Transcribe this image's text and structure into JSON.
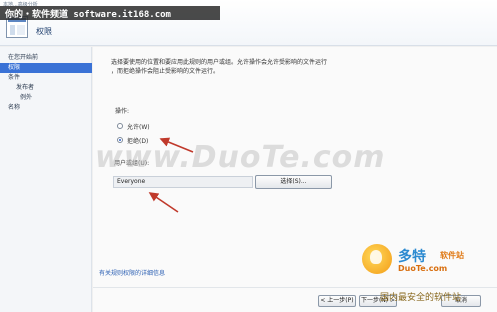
{
  "window": {
    "title": "本地...高级分析"
  },
  "header": {
    "title": "权限"
  },
  "watermark_top": "你的・软件频道 software.it168.com",
  "watermark_center": "www.DuoTe.com",
  "nav": {
    "items": [
      {
        "label": "在您开始前"
      },
      {
        "label": "权限"
      },
      {
        "label": "条件"
      },
      {
        "label": "发布者"
      },
      {
        "label": "例外"
      },
      {
        "label": "名称"
      }
    ]
  },
  "main": {
    "description_line1": "选择要使用的位置和要应用此规则的用户或组。允许操作会允许受影响的文件运行",
    "description_line2": "，而拒绝操作会阻止受影响的文件运行。",
    "operation_label": "操作:",
    "radio_allow": "允许(W)",
    "radio_deny": "拒绝(D)",
    "selected_operation": "拒绝(D)",
    "user_group_label": "用户或组(U):",
    "user_group_value": "Everyone",
    "select_button": "选择(S)...",
    "help_link": "有关规则权限的详细信息"
  },
  "footer": {
    "prev_button": "< 上一步(P)",
    "next_button": "下一步(N) >",
    "cancel_button": "取消"
  },
  "logo": {
    "cn": "多特",
    "cn2": "软件站",
    "en": "DuoTe.com",
    "slogan": "国内最安全的软件站"
  },
  "colors": {
    "selected_nav": "#3a72d6",
    "arrow": "#c0392b",
    "link": "#2b5fb3"
  }
}
